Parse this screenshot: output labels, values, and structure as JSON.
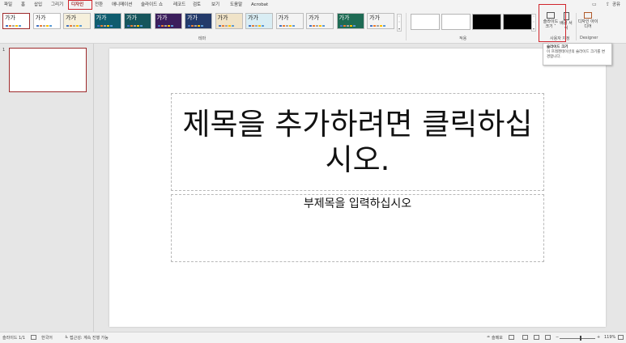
{
  "menubar": {
    "tabs": [
      {
        "label": "파일"
      },
      {
        "label": "홈"
      },
      {
        "label": "삽입"
      },
      {
        "label": "그리기"
      },
      {
        "label": "디자인"
      },
      {
        "label": "전환"
      },
      {
        "label": "애니메이션"
      },
      {
        "label": "슬라이드 쇼"
      },
      {
        "label": "레코드"
      },
      {
        "label": "검토"
      },
      {
        "label": "보기"
      },
      {
        "label": "도움말"
      },
      {
        "label": "Acrobat"
      }
    ],
    "share_label": "공유"
  },
  "ribbon": {
    "themes_group_label": "테마",
    "variants_group_label": "적용",
    "customize_group_label": "사용자 지정",
    "designer_group_label": "Designer",
    "theme_sample_text": "가가",
    "slide_size_label": "슬라이드 크기 ˅",
    "format_bg_label": "배경 서식",
    "design_ideas_label": "디자인 아이디어",
    "theme_colors": [
      "#ffffff",
      "#ffffff",
      "#f6f0dc",
      "#0f5c6e",
      "#16555c",
      "#3b1e5c",
      "#233a6a",
      "#f0e3c8",
      "#d9edf4",
      "#f3f3f3",
      "#f3f3f3",
      "#1e6b54",
      "#f3f3f3"
    ],
    "variant_colors": [
      "#ffffff",
      "#ffffff",
      "#000000",
      "#000000"
    ]
  },
  "tooltip": {
    "title": "슬라이드 크기",
    "body": "이 프레젠테이션의 슬라이드 크기를 변경합니다."
  },
  "slides": {
    "current_number": "1"
  },
  "slide": {
    "title": "제목을 추가하려면 클릭하십시오.",
    "subtitle": "부제목을 입력하십시오"
  },
  "status": {
    "slide_counter": "슬라이드 1/1",
    "language": "한국어",
    "accessibility": "접근성: 계속 진행 가능",
    "notes": "슬메모",
    "zoom": "119%"
  },
  "colors": {
    "accent": "#9e2a2b",
    "highlight": "#d0252c"
  }
}
